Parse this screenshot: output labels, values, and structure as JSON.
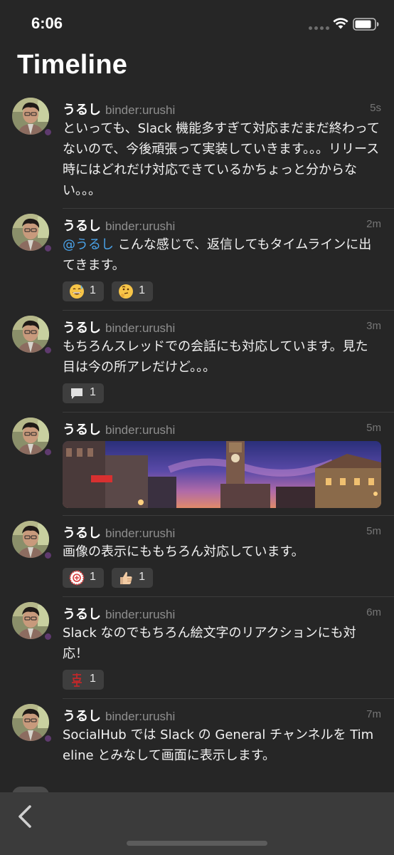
{
  "status_bar": {
    "time": "6:06"
  },
  "header": {
    "title": "Timeline"
  },
  "colors": {
    "background": "#262626",
    "mention": "#4aa3ea",
    "reaction_chip": "#3e3e3e",
    "toolbar": "#3b3b3b"
  },
  "posts": [
    {
      "name": "うるし",
      "handle": "binder:urushi",
      "time": "5s",
      "text": "といっても、Slack 機能多すぎて対応まだまだ終わってないので、今後頑張って実装していきます。。。リリース時にはどれだけ対応できているかちょっと分からない。。。"
    },
    {
      "name": "うるし",
      "handle": "binder:urushi",
      "time": "2m",
      "mention": "@うるし",
      "text": " こんな感じで、返信してもタイムラインに出てきます。",
      "reactions": [
        {
          "icon": "grinning-sweat-emoji",
          "count": "1"
        },
        {
          "icon": "thinking-face-emoji",
          "count": "1"
        }
      ]
    },
    {
      "name": "うるし",
      "handle": "binder:urushi",
      "time": "3m",
      "text": "もちろんスレッドでの会話にも対応しています。見た目は今の所アレだけど。。。",
      "thread_count": "1"
    },
    {
      "name": "うるし",
      "handle": "binder:urushi",
      "time": "5m",
      "image": "city-clocktower-dusk-photo"
    },
    {
      "name": "うるし",
      "handle": "binder:urushi",
      "time": "5m",
      "text": "画像の表示にももちろん対応しています。",
      "reactions": [
        {
          "icon": "custom-red-badge-emoji",
          "count": "1"
        },
        {
          "icon": "thumbs-up-emoji",
          "count": "1"
        }
      ]
    },
    {
      "name": "うるし",
      "handle": "binder:urushi",
      "time": "6m",
      "text": "Slack なのでもちろん絵文字のリアクションにも対応！",
      "reactions": [
        {
          "icon": "custom-red-kanji-emoji",
          "count": "1"
        }
      ]
    },
    {
      "name": "うるし",
      "handle": "binder:urushi",
      "time": "7m",
      "text": "SocialHub では Slack の General チャンネルを Timeline とみなして画面に表示します。"
    }
  ]
}
